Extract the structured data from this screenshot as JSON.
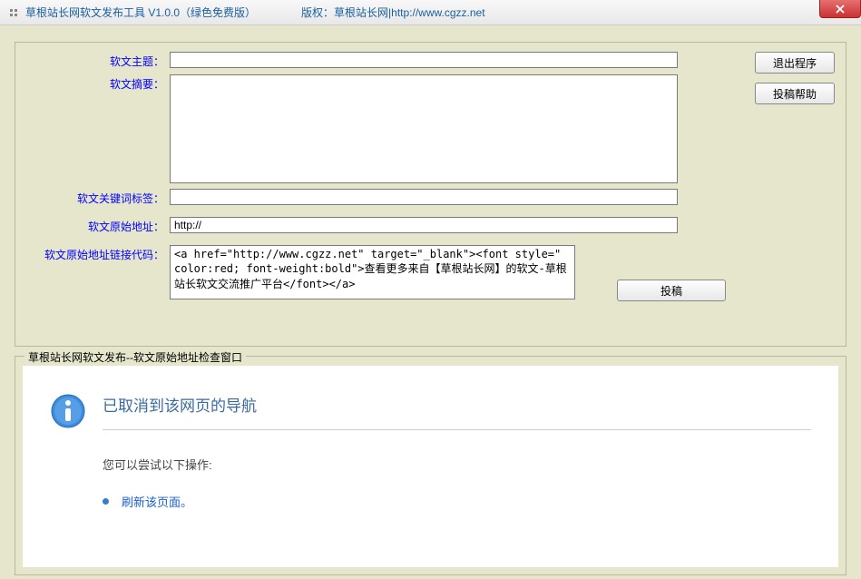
{
  "titlebar": {
    "app_title": "草根站长网软文发布工具 V1.0.0（绿色免费版）",
    "copyright": "版权：草根站长网|http://www.cgzz.net"
  },
  "buttons": {
    "exit": "退出程序",
    "help": "投稿帮助",
    "submit": "投稿"
  },
  "form": {
    "subject_label": "软文主题：",
    "subject_value": "",
    "summary_label": "软文摘要：",
    "summary_value": "",
    "keywords_label": "软文关键词标签：",
    "keywords_value": "",
    "url_label": "软文原始地址：",
    "url_value": "http://",
    "linkcode_label": "软文原始地址链接代码：",
    "linkcode_value": "<a href=\"http://www.cgzz.net\" target=\"_blank\"><font style=\" color:red; font-weight:bold\">查看更多来自【草根站长网】的软文-草根站长软文交流推广平台</font></a>"
  },
  "preview": {
    "group_title": "草根站长网软文发布--软文原始地址检查窗口",
    "heading": "已取消到该网页的导航",
    "tryline": "您可以尝试以下操作:",
    "refresh": "刷新该页面。"
  }
}
